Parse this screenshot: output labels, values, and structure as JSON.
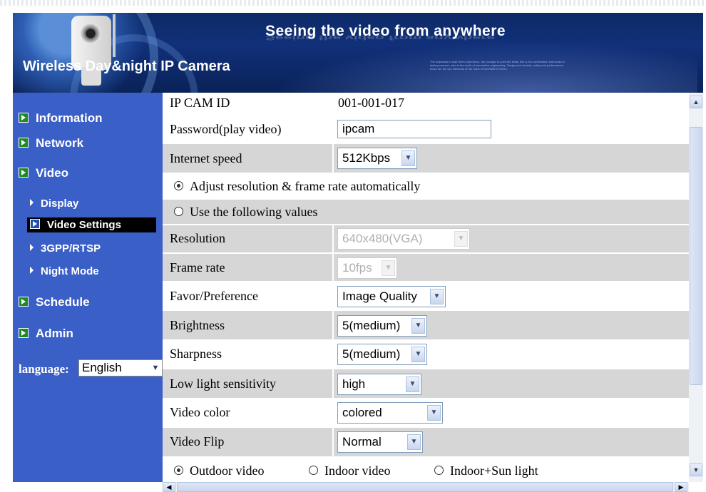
{
  "header": {
    "tagline": "Seeing the video from anywhere",
    "brand": "Wireless Day&night IP Camera",
    "fine_print": "The emphasis to learn from experience, the courage to push the limits, this is the combination that leads to lasting success, also in the world of automotive engineering. Design and comfort, safety and performance: these are the key elements of the value of the BMW 5 Series."
  },
  "sidebar": {
    "items": [
      {
        "label": "Information"
      },
      {
        "label": "Network"
      },
      {
        "label": "Video"
      },
      {
        "label": "Display"
      },
      {
        "label": "Video Settings"
      },
      {
        "label": "3GPP/RTSP"
      },
      {
        "label": "Night Mode"
      },
      {
        "label": "Schedule"
      },
      {
        "label": "Admin"
      }
    ],
    "language_label": "language:",
    "language_value": "English"
  },
  "form": {
    "ipcam_id_label": "IP CAM ID",
    "ipcam_id_value": "001-001-017",
    "password_label": "Password(play video)",
    "password_value": "ipcam",
    "internet_speed_label": "Internet speed",
    "internet_speed_value": "512Kbps",
    "auto_option": "Adjust resolution & frame rate automatically",
    "manual_option": "Use the following values",
    "resolution_label": "Resolution",
    "resolution_value": "640x480(VGA)",
    "frame_rate_label": "Frame rate",
    "frame_rate_value": "10fps",
    "favor_label": "Favor/Preference",
    "favor_value": "Image Quality",
    "brightness_label": "Brightness",
    "brightness_value": "5(medium)",
    "sharpness_label": "Sharpness",
    "sharpness_value": "5(medium)",
    "low_light_label": "Low light sensitivity",
    "low_light_value": "high",
    "video_color_label": "Video color",
    "video_color_value": "colored",
    "video_flip_label": "Video Flip",
    "video_flip_value": "Normal",
    "env_options": [
      "Outdoor video",
      "Indoor video",
      "Indoor+Sun light"
    ],
    "env_selected": "Outdoor video"
  },
  "icons": {
    "dropdown": "chevron-down-icon",
    "scroll_up": "arrow-up-icon",
    "scroll_down": "arrow-down-icon",
    "scroll_left": "arrow-left-icon",
    "scroll_right": "arrow-right-icon"
  },
  "colors": {
    "sidebar_bg": "#3a5fc7",
    "row_gray": "#d6d6d6",
    "header_bg": "#11307a",
    "active_item_bg": "#000000"
  }
}
